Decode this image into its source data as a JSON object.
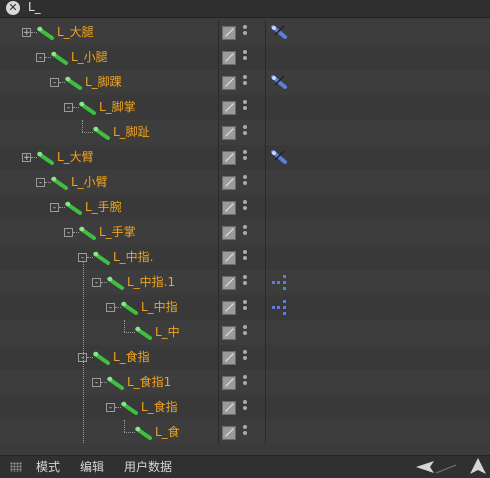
{
  "search": {
    "value": "L_",
    "clear_icon": "close-icon"
  },
  "tree": {
    "rows": [
      {
        "label": "L_大腿",
        "depth": 0,
        "expander": "+",
        "tag": "bone-tag"
      },
      {
        "label": "L_小腿",
        "depth": 1,
        "expander": "-",
        "tag": ""
      },
      {
        "label": "L_脚踝",
        "depth": 2,
        "expander": "-",
        "tag": "bone-tag"
      },
      {
        "label": "L_脚掌",
        "depth": 3,
        "expander": "-",
        "tag": ""
      },
      {
        "label": "L_脚趾",
        "depth": 4,
        "expander": "",
        "tag": ""
      },
      {
        "label": "L_大臂",
        "depth": 0,
        "expander": "+",
        "tag": "bone-tag"
      },
      {
        "label": "L_小臂",
        "depth": 1,
        "expander": "-",
        "tag": ""
      },
      {
        "label": "L_手腕",
        "depth": 2,
        "expander": "-",
        "tag": ""
      },
      {
        "label": "L_手掌",
        "depth": 3,
        "expander": "-",
        "tag": ""
      },
      {
        "label": "L_中指.",
        "depth": 4,
        "expander": "-",
        "tag": ""
      },
      {
        "label": "L_中指.1",
        "depth": 5,
        "expander": "-",
        "tag": "ik-tag"
      },
      {
        "label": "L_中指",
        "depth": 6,
        "expander": "-",
        "tag": "ik-tag"
      },
      {
        "label": "L_中",
        "depth": 7,
        "expander": "",
        "tag": ""
      },
      {
        "label": "L_食指",
        "depth": 4,
        "expander": "-",
        "tag": ""
      },
      {
        "label": "L_食指1",
        "depth": 5,
        "expander": "-",
        "tag": ""
      },
      {
        "label": "L_食指",
        "depth": 6,
        "expander": "-",
        "tag": ""
      },
      {
        "label": "L_食",
        "depth": 7,
        "expander": "",
        "tag": ""
      }
    ]
  },
  "bottom_bar": {
    "grip_icon": "grip-icon",
    "menu": [
      "模式",
      "编辑",
      "用户数据"
    ],
    "nav_back_icon": "arrow-left-icon",
    "nav_up_icon": "arrow-up-icon"
  },
  "colors": {
    "label": "#f0a31e",
    "bone_green": "#3fbf3f",
    "tag_blue": "#5a7fd8"
  }
}
